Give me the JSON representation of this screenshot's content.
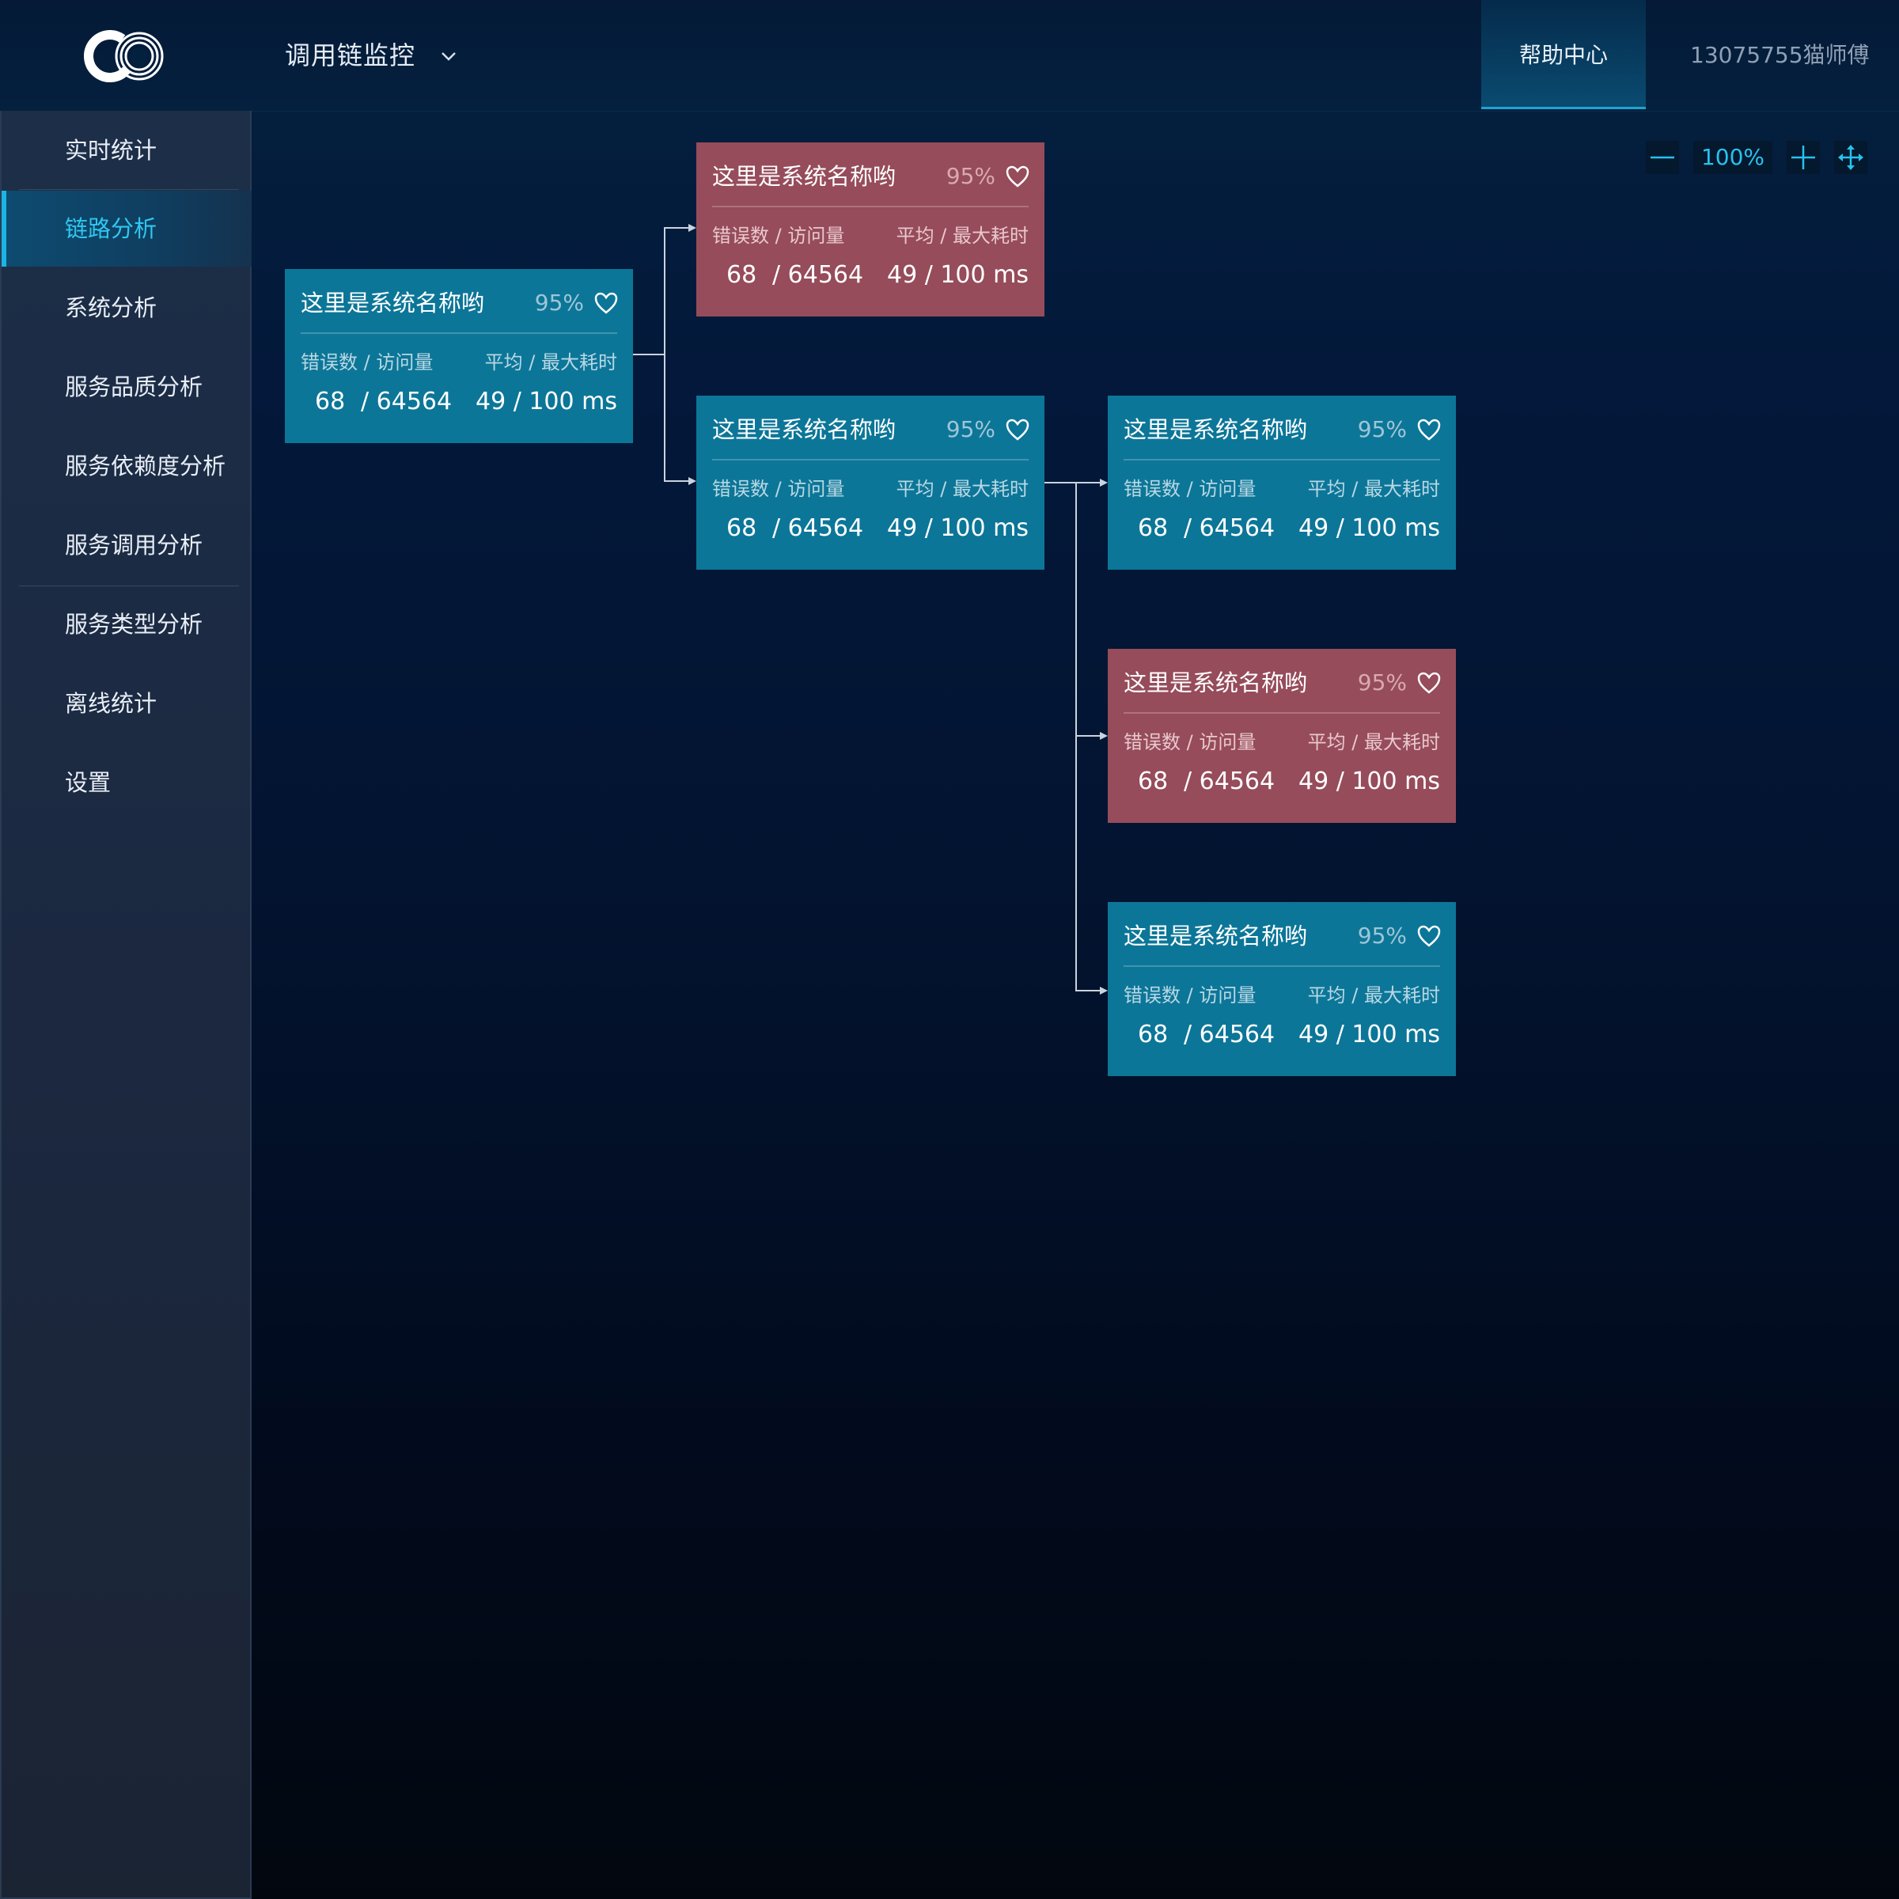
{
  "header": {
    "logo_icon": "co-logo-icon",
    "app_title": "调用链监控",
    "dropdown_icon": "chevron-down-icon",
    "help_label": "帮助中心",
    "user_label": "13075755猫师傅"
  },
  "sidebar": {
    "items": [
      {
        "label": "实时统计"
      },
      {
        "label": "链路分析",
        "active": true
      },
      {
        "label": "系统分析"
      },
      {
        "label": "服务品质分析"
      },
      {
        "label": "服务依赖度分析"
      },
      {
        "label": "服务调用分析"
      },
      {
        "label": "服务类型分析"
      },
      {
        "label": "离线统计"
      },
      {
        "label": "设置"
      }
    ]
  },
  "zoom": {
    "level": "100%",
    "minus_icon": "zoom-out-icon",
    "plus_icon": "zoom-in-icon",
    "fit_icon": "move-arrows-icon"
  },
  "colors": {
    "ok": "#0c7698",
    "error": "#964c5a",
    "accent": "#27c2ee"
  },
  "nodes": [
    {
      "name": "这里是系统名称哟",
      "percent": "95%",
      "status": "ok",
      "metric_label_1": "错误数 / 访问量",
      "metric_label_2": "平均 / 最大耗时",
      "errors": "68",
      "visits": "/ 64564",
      "latency": "49 / 100 ms"
    },
    {
      "name": "这里是系统名称哟",
      "percent": "95%",
      "status": "error",
      "metric_label_1": "错误数 / 访问量",
      "metric_label_2": "平均 / 最大耗时",
      "errors": "68",
      "visits": "/ 64564",
      "latency": "49 / 100 ms"
    },
    {
      "name": "这里是系统名称哟",
      "percent": "95%",
      "status": "ok",
      "metric_label_1": "错误数 / 访问量",
      "metric_label_2": "平均 / 最大耗时",
      "errors": "68",
      "visits": "/ 64564",
      "latency": "49 / 100 ms"
    },
    {
      "name": "这里是系统名称哟",
      "percent": "95%",
      "status": "ok",
      "metric_label_1": "错误数 / 访问量",
      "metric_label_2": "平均 / 最大耗时",
      "errors": "68",
      "visits": "/ 64564",
      "latency": "49 / 100 ms"
    },
    {
      "name": "这里是系统名称哟",
      "percent": "95%",
      "status": "error",
      "metric_label_1": "错误数 / 访问量",
      "metric_label_2": "平均 / 最大耗时",
      "errors": "68",
      "visits": "/ 64564",
      "latency": "49 / 100 ms"
    },
    {
      "name": "这里是系统名称哟",
      "percent": "95%",
      "status": "ok",
      "metric_label_1": "错误数 / 访问量",
      "metric_label_2": "平均 / 最大耗时",
      "errors": "68",
      "visits": "/ 64564",
      "latency": "49 / 100 ms"
    }
  ]
}
